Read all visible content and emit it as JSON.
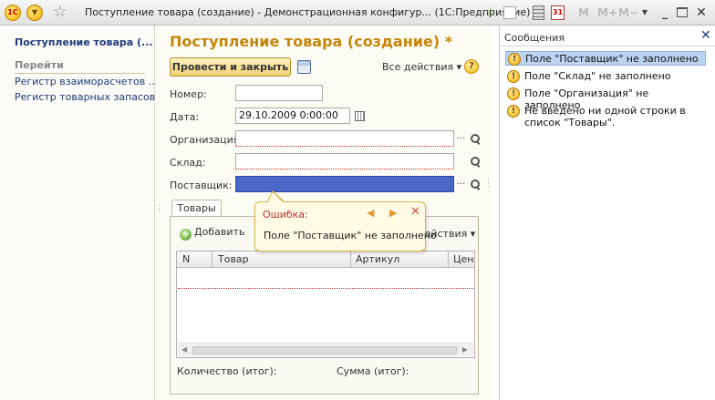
{
  "titlebar": {
    "logo_text": "1С",
    "title": "Поступление товара (создание) - Демонстрационная конфигур...  (1С:Предприятие)",
    "calendar_text": "31",
    "m_label": "M",
    "mplus_label": "M+",
    "mminus_label": "M−",
    "icons": [
      "1c-logo-icon",
      "main-menu-icon",
      "favorites-star-icon",
      "link-icon",
      "document-icon",
      "calculator-icon",
      "calendar-icon",
      "minimize-icon",
      "maximize-icon",
      "close-icon"
    ]
  },
  "nav": {
    "title": "Поступление товара (...",
    "goto_label": "Перейти",
    "links": [
      "Регистр взаиморасчетов ...",
      "Регистр товарных запасов"
    ]
  },
  "form": {
    "title": "Поступление товара (создание) *",
    "post_close_label": "Провести и закрыть",
    "all_actions_label": "Все действия ▾",
    "help_label": "?",
    "fields": {
      "number": {
        "label": "Номер:",
        "value": ""
      },
      "date": {
        "label": "Дата:",
        "value": "29.10.2009  0:00:00"
      },
      "organization": {
        "label": "Организация:",
        "value": ""
      },
      "warehouse": {
        "label": "Склад:",
        "value": ""
      },
      "supplier": {
        "label": "Поставщик:",
        "value": ""
      }
    },
    "dots_label": "...",
    "tab_label": "Товары",
    "add_label": "Добавить",
    "table_actions_label": "действия ▾",
    "table": {
      "columns": [
        "N",
        "Товар",
        "Артикул",
        "Цена"
      ],
      "rows": []
    },
    "qty_total_label": "Количество (итог):",
    "sum_total_label": "Сумма (итог):"
  },
  "error_tooltip": {
    "title": "Ошибка:",
    "text": "Поле \"Поставщик\" не заполнено",
    "prev_glyph": "◀",
    "next_glyph": "▶",
    "close_glyph": "✕"
  },
  "messages": {
    "title": "Сообщения",
    "close_glyph": "✕",
    "items": [
      "Поле \"Поставщик\" не заполнено",
      "Поле \"Склад\" не заполнено",
      "Поле \"Организация\" не заполнено",
      "Не введено ни одной строки в список \"Товары\"."
    ]
  },
  "colors": {
    "accent_title": "#c4850a",
    "link": "#1f3b7a",
    "selected_input": "#4b67c6",
    "selected_message": "#bdd3f2",
    "error_text": "#c62a2a"
  }
}
